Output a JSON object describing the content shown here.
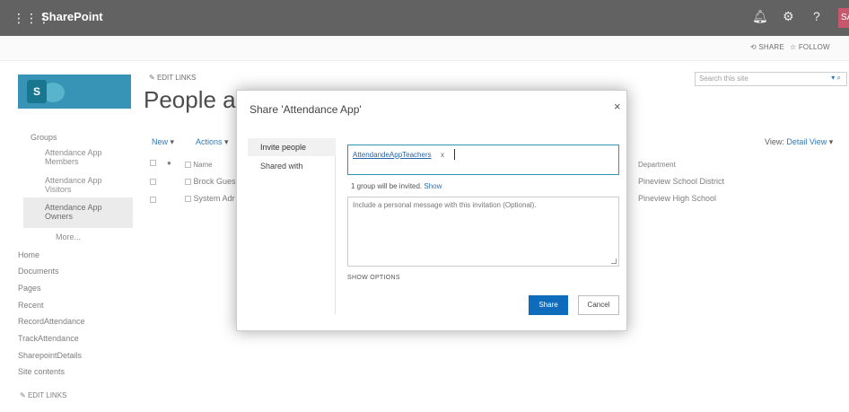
{
  "suitebar": {
    "brand": "SharePoint",
    "avatar_initials": "SA"
  },
  "ribbon": {
    "share": "SHARE",
    "follow": "FOLLOW"
  },
  "header": {
    "edit_links": "EDIT LINKS",
    "title": "People an",
    "search_placeholder": "Search this site"
  },
  "leftnav": {
    "groups_heading": "Groups",
    "groups": [
      "Attendance App Members",
      "Attendance App Visitors",
      "Attendance App Owners",
      "More..."
    ],
    "links": [
      "Home",
      "Documents",
      "Pages",
      "Recent",
      "RecordAttendance",
      "TrackAttendance",
      "SharepointDetails",
      "Site contents"
    ],
    "edit_links": "EDIT LINKS"
  },
  "list": {
    "new": "New",
    "actions": "Actions",
    "view_label": "View:",
    "view_value": "Detail View",
    "name_header": "Name",
    "department_header": "Department",
    "rows": [
      {
        "name": "Brock Gues",
        "department": "Pineview School District"
      },
      {
        "name": "System Adr",
        "department": "Pineview High School"
      }
    ]
  },
  "dialog": {
    "title": "Share 'Attendance App'",
    "close": "×",
    "tabs": [
      "Invite people",
      "Shared with"
    ],
    "invitee": "AttendandeAppTeachers",
    "invitee_remove": "x",
    "invite_note": "1 group will be invited.",
    "invite_note_link": "Show",
    "message_placeholder": "Include a personal message with this invitation (Optional).",
    "show_options": "SHOW OPTIONS",
    "share_button": "Share",
    "cancel_button": "Cancel"
  }
}
